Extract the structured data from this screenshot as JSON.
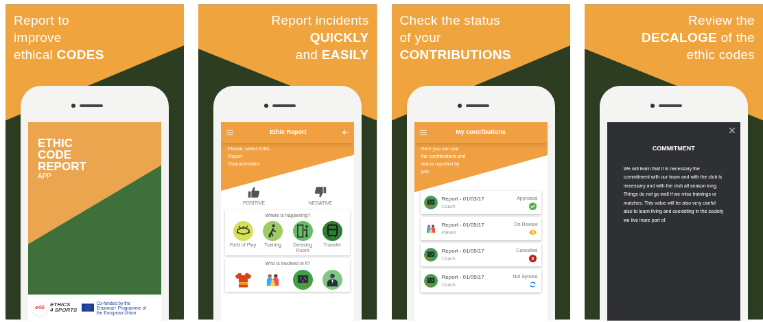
{
  "panels": [
    {
      "headline": [
        "Report to",
        "improve",
        "ethical **CODES**"
      ],
      "screen": {
        "kind": "splash",
        "title_lines": [
          "ETHIC",
          "CODE",
          "REPORT"
        ],
        "subtitle": "APP",
        "brand_logo": "e4S",
        "brand_lines": [
          "ETHICS",
          "4 SPORTS"
        ],
        "funding_note": "Co-funded by the Erasmus+ Programme of the European Union"
      }
    },
    {
      "headline": [
        "Report incidents",
        "**QUICKLY**",
        "and **EASILY**"
      ],
      "screen": {
        "kind": "report",
        "title": "Ethic Report",
        "intro": "Please, select Ethic Report Characteristics",
        "votes": [
          {
            "label": "POSITIVE",
            "kind": "up"
          },
          {
            "label": "NEGATIVE",
            "kind": "down"
          }
        ],
        "sections": [
          {
            "heading": "Where is happening?",
            "options": [
              {
                "label": "Field of Play",
                "kind": "stadium",
                "color": "#d4e157"
              },
              {
                "label": "Training",
                "kind": "player",
                "color": "#9ccc65"
              },
              {
                "label": "Dressing Room",
                "kind": "room",
                "color": "#66bb6a"
              },
              {
                "label": "Transfer",
                "kind": "bus",
                "color": "#2e7d32"
              }
            ]
          },
          {
            "heading": "Who is involved in it?",
            "options": [
              {
                "kind": "jersey"
              },
              {
                "kind": "family"
              },
              {
                "kind": "board",
                "color": "#43a047"
              },
              {
                "kind": "official",
                "color": "#81c784"
              }
            ]
          }
        ]
      }
    },
    {
      "headline": [
        "Check the status",
        "of your",
        "**CONTRIBUTIONS**"
      ],
      "screen": {
        "kind": "contributions",
        "title": "My contributions",
        "intro": "Here you can see the contributions and status reported by you",
        "rows": [
          {
            "title": "Report - 01/03/17",
            "role": "Coach",
            "avatar": {
              "kind": "board"
            },
            "status": {
              "label": "Approbed",
              "kind": "approved"
            }
          },
          {
            "title": "Report - 01/05/17",
            "role": "Parent",
            "avatar": {
              "kind": "family"
            },
            "status": {
              "label": "On Review",
              "kind": "review"
            }
          },
          {
            "title": "Report - 01/05/17",
            "role": "Coach",
            "avatar": {
              "kind": "board"
            },
            "status": {
              "label": "Cancelled",
              "kind": "cancelled"
            }
          },
          {
            "title": "Report - 01/05/17",
            "role": "Coach",
            "avatar": {
              "kind": "board"
            },
            "status": {
              "label": "Not Synced",
              "kind": "unsynced"
            }
          }
        ]
      }
    },
    {
      "headline": [
        "Review the",
        "**DECALOGE** of the",
        "ethic codes"
      ],
      "screen": {
        "kind": "decalogue",
        "heading": "COMMITMENT",
        "body": "We will learn that it is necessary the commitment with our team and with the club is necessary and with the club all season long. Things do not go well if we miss trainings or matches. This value will be also very useful also to learn living and coexisting in the society we live inare part of."
      }
    }
  ]
}
